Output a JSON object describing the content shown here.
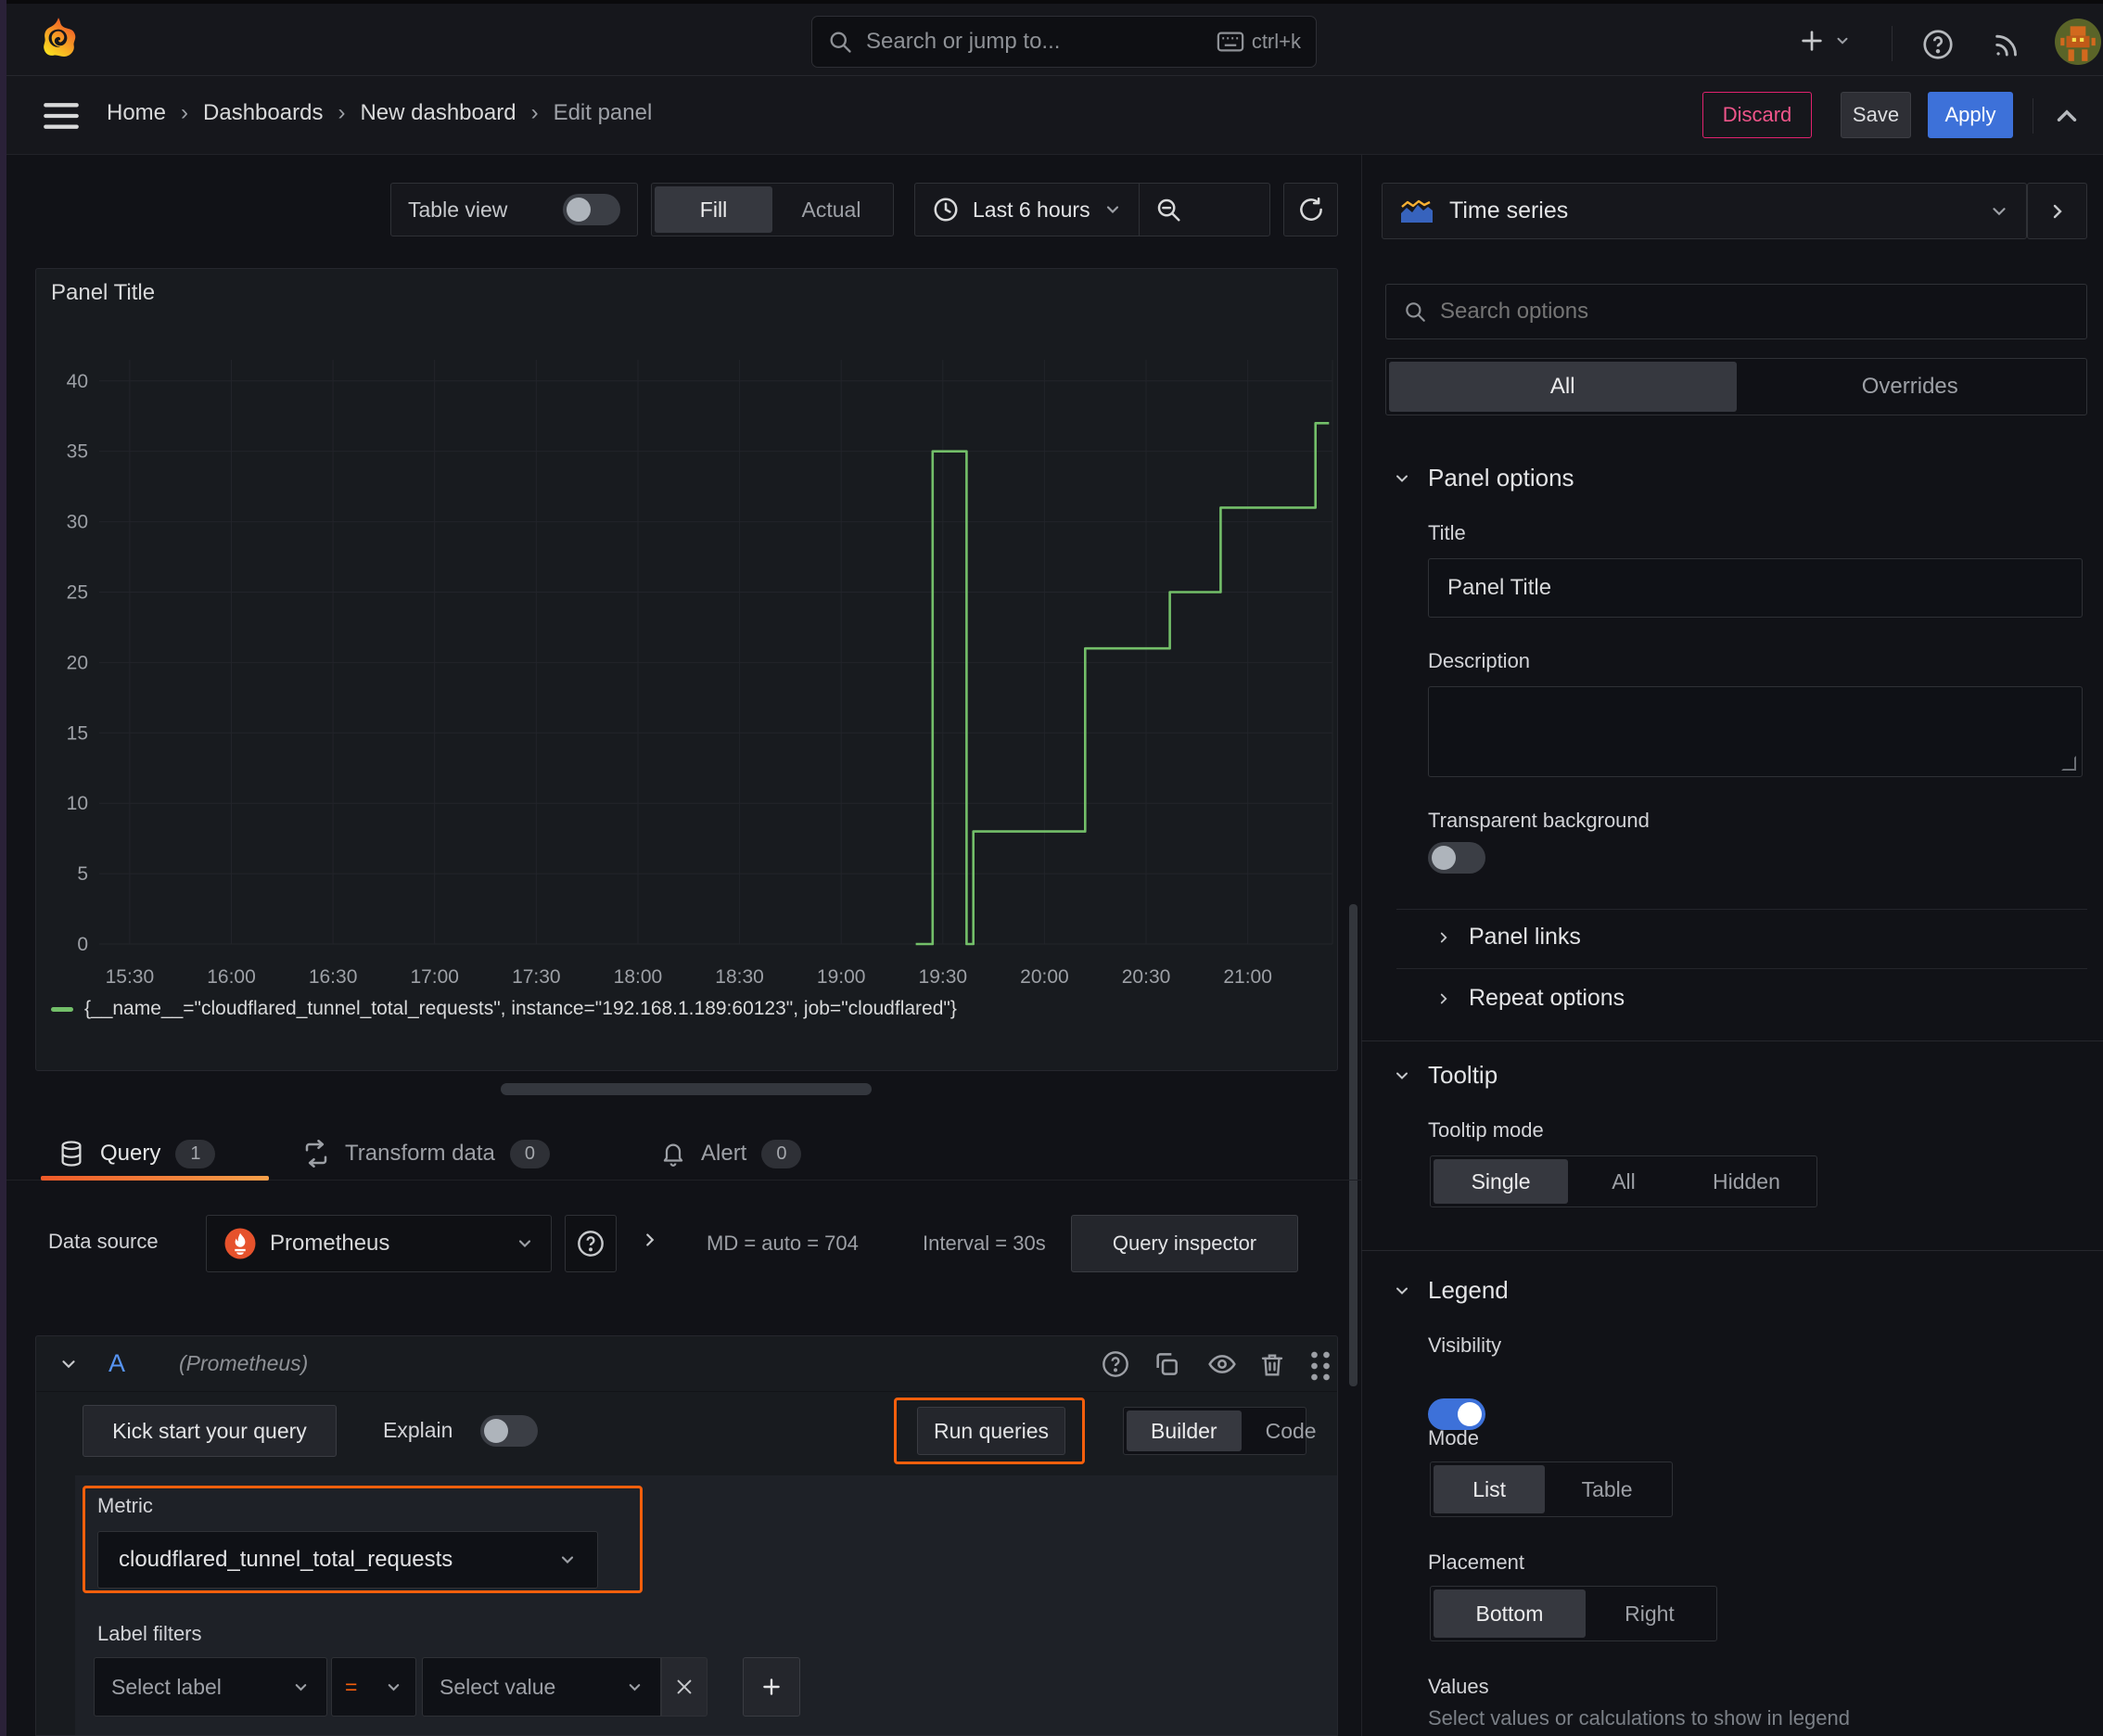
{
  "topnav": {
    "search_placeholder": "Search or jump to...",
    "shortcut": "ctrl+k"
  },
  "breadcrumb": {
    "separator": "›",
    "items": [
      "Home",
      "Dashboards",
      "New dashboard",
      "Edit panel"
    ]
  },
  "actions": {
    "discard": "Discard",
    "save": "Save",
    "apply": "Apply"
  },
  "toolbar": {
    "table_view": "Table view",
    "fill": "Fill",
    "actual": "Actual",
    "time_range": "Last 6 hours"
  },
  "panel": {
    "title": "Panel Title"
  },
  "chart_data": {
    "type": "line",
    "interpolation": "step-after",
    "title": "Panel Title",
    "grid": true,
    "legend_position": "bottom",
    "x_ticks": [
      "15:30",
      "16:00",
      "16:30",
      "17:00",
      "17:30",
      "18:00",
      "18:30",
      "19:00",
      "19:30",
      "20:00",
      "20:30",
      "21:00"
    ],
    "x_domain": [
      "15:21",
      "21:25"
    ],
    "y_ticks": [
      0,
      5,
      10,
      15,
      20,
      25,
      30,
      35,
      40
    ],
    "y_domain": [
      0,
      41.5
    ],
    "series": [
      {
        "name": "{__name__=\"cloudflared_tunnel_total_requests\", instance=\"192.168.1.189:60123\", job=\"cloudflared\"}",
        "color": "#73bf69",
        "points": [
          [
            "19:22",
            0
          ],
          [
            "19:27",
            35
          ],
          [
            "19:37",
            0
          ],
          [
            "19:39",
            8
          ],
          [
            "20:12",
            21
          ],
          [
            "20:37",
            25
          ],
          [
            "20:52",
            31
          ],
          [
            "21:20",
            37
          ],
          [
            "21:24",
            37
          ]
        ]
      }
    ]
  },
  "tabs": {
    "query": {
      "label": "Query",
      "count": "1"
    },
    "transform": {
      "label": "Transform data",
      "count": "0"
    },
    "alert": {
      "label": "Alert",
      "count": "0"
    }
  },
  "datasource": {
    "label": "Data source",
    "name": "Prometheus",
    "md": "MD = auto = 704",
    "interval": "Interval = 30s",
    "inspector": "Query inspector"
  },
  "query": {
    "ref": "A",
    "hint": "(Prometheus)"
  },
  "editor": {
    "kickstart": "Kick start your query",
    "explain": "Explain",
    "run": "Run queries",
    "builder": "Builder",
    "code": "Code",
    "metric": {
      "label": "Metric",
      "value": "cloudflared_tunnel_total_requests"
    },
    "filters": {
      "label": "Label filters",
      "select_label": "Select label",
      "op": "=",
      "select_value": "Select value"
    }
  },
  "sidebar": {
    "viz": "Time series",
    "search_placeholder": "Search options",
    "tabs": {
      "all": "All",
      "overrides": "Overrides"
    },
    "panel_options": {
      "header": "Panel options",
      "title_label": "Title",
      "title_value": "Panel Title",
      "description_label": "Description",
      "transparent_label": "Transparent background"
    },
    "panel_links": "Panel links",
    "repeat_options": "Repeat options",
    "tooltip": {
      "header": "Tooltip",
      "mode_label": "Tooltip mode",
      "options": [
        "Single",
        "All",
        "Hidden"
      ]
    },
    "legend": {
      "header": "Legend",
      "visibility_label": "Visibility",
      "mode_label": "Mode",
      "mode_options": [
        "List",
        "Table"
      ],
      "placement_label": "Placement",
      "placement_options": [
        "Bottom",
        "Right"
      ],
      "values_label": "Values",
      "values_hint": "Select values or calculations to show in legend"
    }
  },
  "colors": {
    "accent_orange": "#f55f0c",
    "series_green": "#73bf69",
    "primary_blue": "#3d71d9",
    "danger_pink": "#e0226e"
  }
}
